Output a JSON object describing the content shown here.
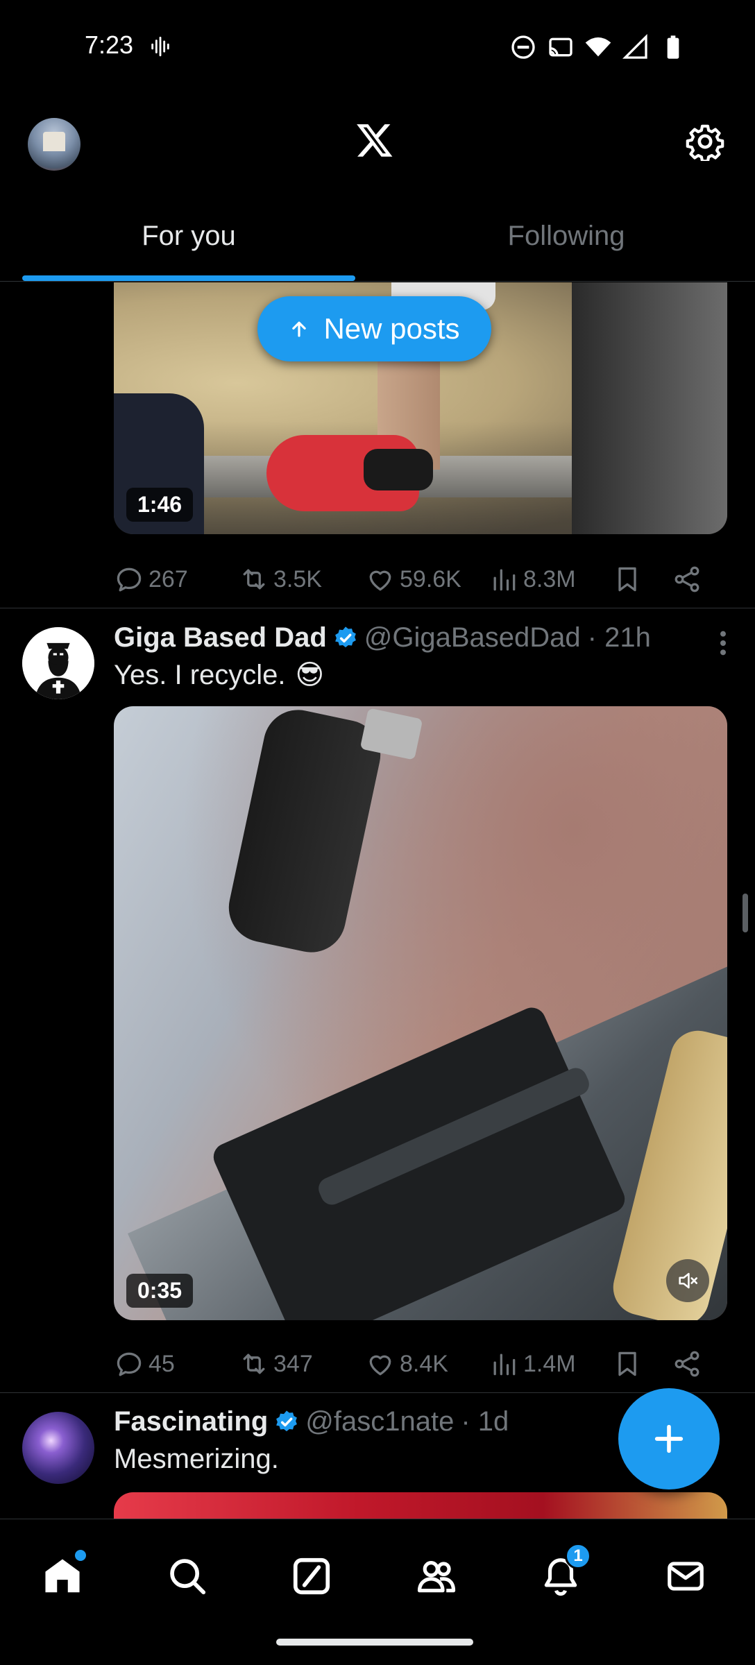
{
  "status_bar": {
    "time": "7:23"
  },
  "header": {
    "logo": "x-logo-icon",
    "settings_icon": "gear-icon"
  },
  "tabs": [
    {
      "label": "For you",
      "active": true
    },
    {
      "label": "Following",
      "active": false
    }
  ],
  "new_posts_label": "New posts",
  "posts": [
    {
      "video_duration": "1:46",
      "stats": {
        "replies": "267",
        "reposts": "3.5K",
        "likes": "59.6K",
        "views": "8.3M"
      }
    },
    {
      "author": "Giga Based Dad",
      "handle": "@GigaBasedDad",
      "time": "· 21h",
      "verified": true,
      "text": "Yes. I recycle.",
      "emoji": "😎",
      "video_duration": "0:35",
      "stats": {
        "replies": "45",
        "reposts": "347",
        "likes": "8.4K",
        "views": "1.4M"
      }
    },
    {
      "author": "Fascinating",
      "handle": "@fasc1nate",
      "time": "· 1d",
      "verified": true,
      "text": "Mesmerizing."
    }
  ],
  "bottom_nav": {
    "items": [
      "home-icon",
      "search-icon",
      "grok-icon",
      "communities-icon",
      "notifications-icon",
      "messages-icon"
    ],
    "notification_count": "1"
  },
  "colors": {
    "accent": "#1d9bf0",
    "background": "#000000",
    "text_primary": "#e7e9ea",
    "text_secondary": "#71767b"
  }
}
